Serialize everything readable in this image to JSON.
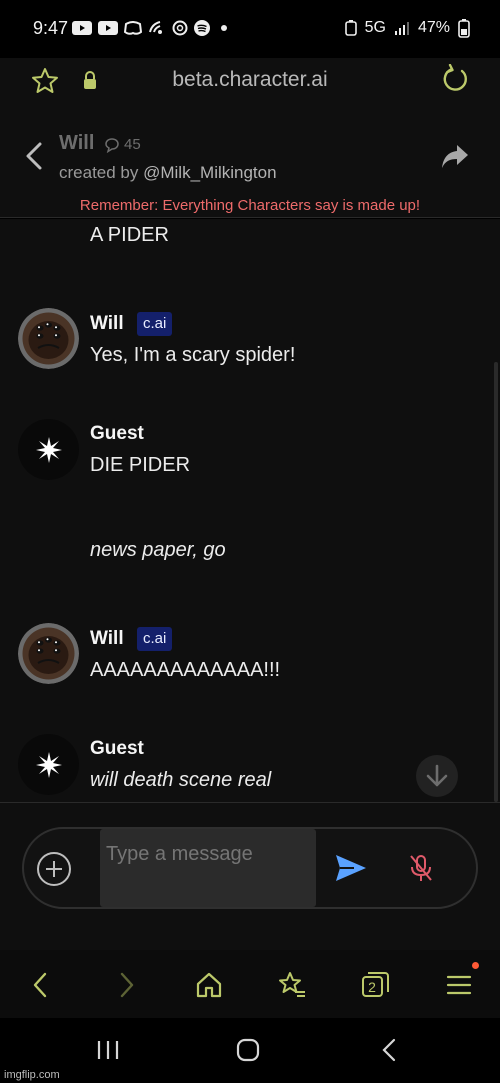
{
  "status_bar": {
    "time": "9:47",
    "notification_icons": [
      "youtube-icon",
      "youtube-icon",
      "discord-icon",
      "wifi-call-icon",
      "threads-icon",
      "spotify-icon",
      "dot-icon"
    ],
    "network": "5G",
    "battery": "47%"
  },
  "browser": {
    "url": "beta.character.ai"
  },
  "chat_header": {
    "character_name": "Will",
    "chat_count": "45",
    "created_by_prefix": "created by ",
    "creator_handle": "@Milk_Milkington",
    "warning": "Remember: Everything Characters say is made up!"
  },
  "messages": [
    {
      "sender": "",
      "text": "A PIDER",
      "italic": false
    },
    {
      "sender": "Will",
      "badge": "c.ai",
      "text": "Yes, I'm a scary spider!",
      "italic": false
    },
    {
      "sender": "Guest",
      "text": "DIE PIDER",
      "italic": false
    },
    {
      "sender": "",
      "text": "news paper, go",
      "italic": true
    },
    {
      "sender": "Will",
      "badge": "c.ai",
      "text": "AAAAAAAAAAAAA!!!",
      "italic": false
    },
    {
      "sender": "Guest",
      "text": "will death scene real",
      "italic": true
    }
  ],
  "composer": {
    "placeholder": "Type a message"
  },
  "bottom_nav": {
    "tabs_count": "2"
  },
  "watermark": "imgflip.com",
  "colors": {
    "accent": "#bcc96a",
    "warning": "#ee6b6b",
    "badge_bg": "#14206b",
    "send": "#5aa2ff",
    "mic_muted": "#e05a6a"
  }
}
